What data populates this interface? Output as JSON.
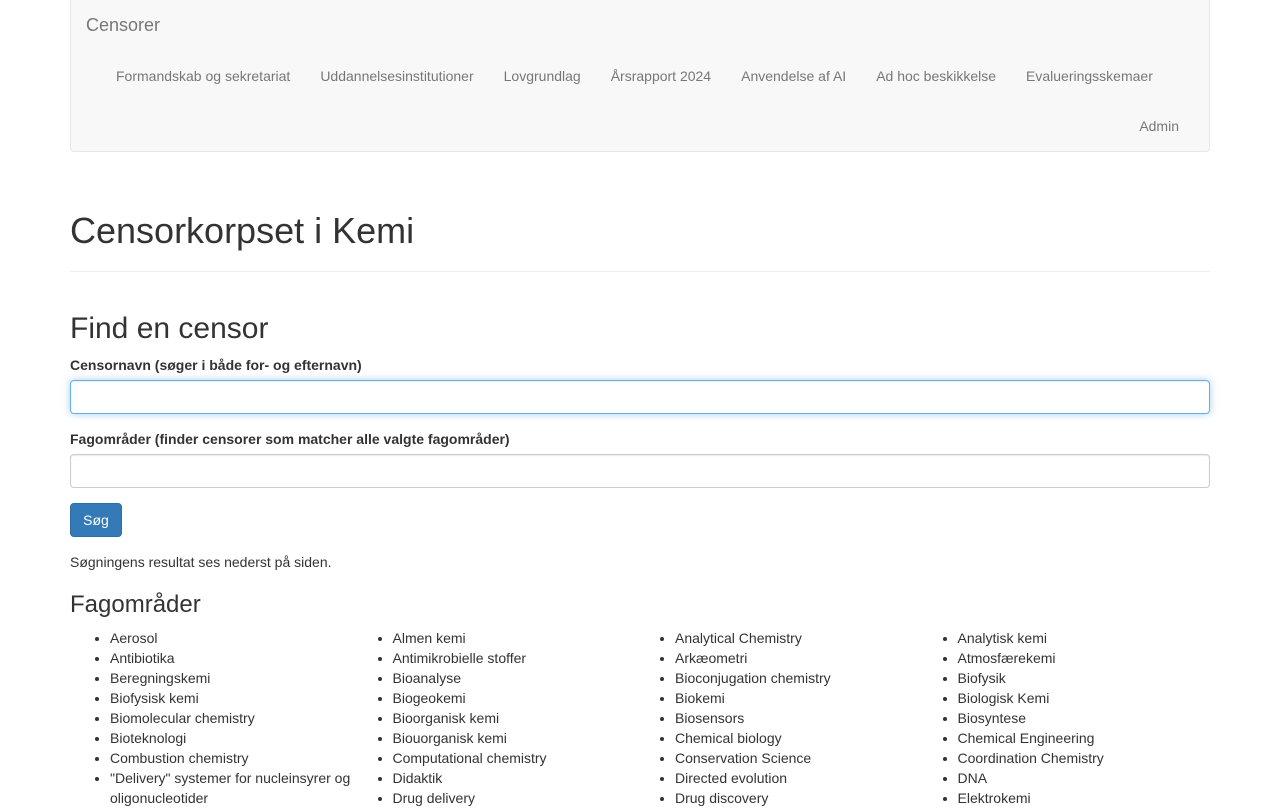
{
  "navbar": {
    "brand": "Censorer",
    "items": [
      "Formandskab og sekretariat",
      "Uddannelsesinstitutioner",
      "Lovgrundlag",
      "Årsrapport 2024",
      "Anvendelse af AI",
      "Ad hoc beskikkelse",
      "Evalueringsskemaer"
    ],
    "admin": "Admin"
  },
  "page_title": "Censorkorpset i Kemi",
  "search": {
    "heading": "Find en censor",
    "name_label": "Censornavn (søger i både for- og efternavn)",
    "name_value": "",
    "areas_label": "Fagområder (finder censorer som matcher alle valgte fagområder)",
    "areas_value": "",
    "button": "Søg",
    "note": "Søgningens resultat ses nederst på siden."
  },
  "areas": {
    "heading": "Fagområder",
    "columns": [
      [
        "Aerosol",
        "Antibiotika",
        "Beregningskemi",
        "Biofysisk kemi",
        "Biomolecular chemistry",
        "Bioteknologi",
        "Combustion chemistry",
        "\"Delivery\" systemer for nucleinsyrer og oligonucleotider"
      ],
      [
        "Almen kemi",
        "Antimikrobielle stoffer",
        "Bioanalyse",
        "Biogeokemi",
        "Bioorganisk kemi",
        "Biouorganisk kemi",
        "Computational chemistry",
        "Didaktik",
        "Drug delivery"
      ],
      [
        "Analytical Chemistry",
        "Arkæometri",
        "Bioconjugation chemistry",
        "Biokemi",
        "Biosensors",
        "Chemical biology",
        "Conservation Science",
        "Directed evolution",
        "Drug discovery"
      ],
      [
        "Analytisk kemi",
        "Atmosfærekemi",
        "Biofysik",
        "Biologisk Kemi",
        "Biosyntese",
        "Chemical Engineering",
        "Coordination Chemistry",
        "DNA",
        "Elektrokemi"
      ]
    ]
  }
}
